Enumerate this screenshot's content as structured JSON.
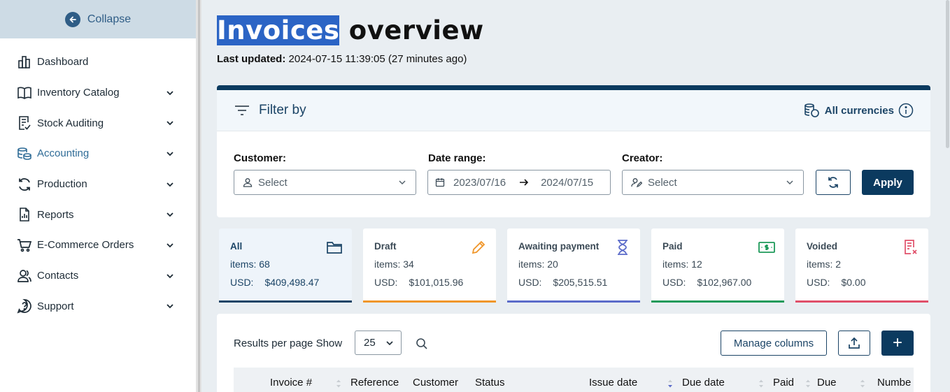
{
  "sidebar": {
    "collapse_label": "Collapse",
    "items": [
      {
        "label": "Dashboard",
        "icon": "dashboard-icon",
        "has_chevron": false
      },
      {
        "label": "Inventory Catalog",
        "icon": "book-icon",
        "has_chevron": true
      },
      {
        "label": "Stock Auditing",
        "icon": "clipboard-check-icon",
        "has_chevron": true
      },
      {
        "label": "Accounting",
        "icon": "coins-icon",
        "has_chevron": true,
        "active": true
      },
      {
        "label": "Production",
        "icon": "refresh-icon",
        "has_chevron": true
      },
      {
        "label": "Reports",
        "icon": "report-icon",
        "has_chevron": true
      },
      {
        "label": "E-Commerce Orders",
        "icon": "cart-icon",
        "has_chevron": true
      },
      {
        "label": "Contacts",
        "icon": "contacts-icon",
        "has_chevron": true
      },
      {
        "label": "Support",
        "icon": "support-icon",
        "has_chevron": true
      }
    ]
  },
  "header": {
    "title_highlight": "Invoices",
    "title_rest": " overview",
    "last_updated_label": "Last updated:",
    "last_updated_value": " 2024-07-15 11:39:05 (27 minutes ago)"
  },
  "filter": {
    "title": "Filter by",
    "currencies_label": "All currencies",
    "customer_label": "Customer:",
    "customer_placeholder": "Select",
    "date_label": "Date range:",
    "date_from": "2023/07/16",
    "date_to": "2024/07/15",
    "creator_label": "Creator:",
    "creator_placeholder": "Select",
    "apply_label": "Apply"
  },
  "stats": [
    {
      "name": "All",
      "items_label": "items:",
      "items": "68",
      "currency": "USD:",
      "amount": "$409,498.47",
      "color": "#1b4466",
      "icon": "folder-icon",
      "selected": true
    },
    {
      "name": "Draft",
      "items_label": "items:",
      "items": "34",
      "currency": "USD:",
      "amount": "$101,015.96",
      "color": "#f0962a",
      "icon": "pencil-icon"
    },
    {
      "name": "Awaiting payment",
      "items_label": "items:",
      "items": "20",
      "currency": "USD:",
      "amount": "$205,515.51",
      "color": "#5b6bc9",
      "icon": "hourglass-icon"
    },
    {
      "name": "Paid",
      "items_label": "items:",
      "items": "12",
      "currency": "USD:",
      "amount": "$102,967.00",
      "color": "#1e9a5a",
      "icon": "money-icon"
    },
    {
      "name": "Voided",
      "items_label": "items:",
      "items": "2",
      "currency": "USD:",
      "amount": "$0.00",
      "color": "#e0506a",
      "icon": "void-invoice-icon"
    }
  ],
  "table": {
    "results_label": "Results per page Show",
    "page_size": "25",
    "manage_columns_label": "Manage columns",
    "add_label": "+",
    "columns": [
      "Invoice #",
      "Reference",
      "Customer",
      "Status",
      "Issue date",
      "Due date",
      "Paid",
      "Due",
      "Numbe"
    ]
  }
}
